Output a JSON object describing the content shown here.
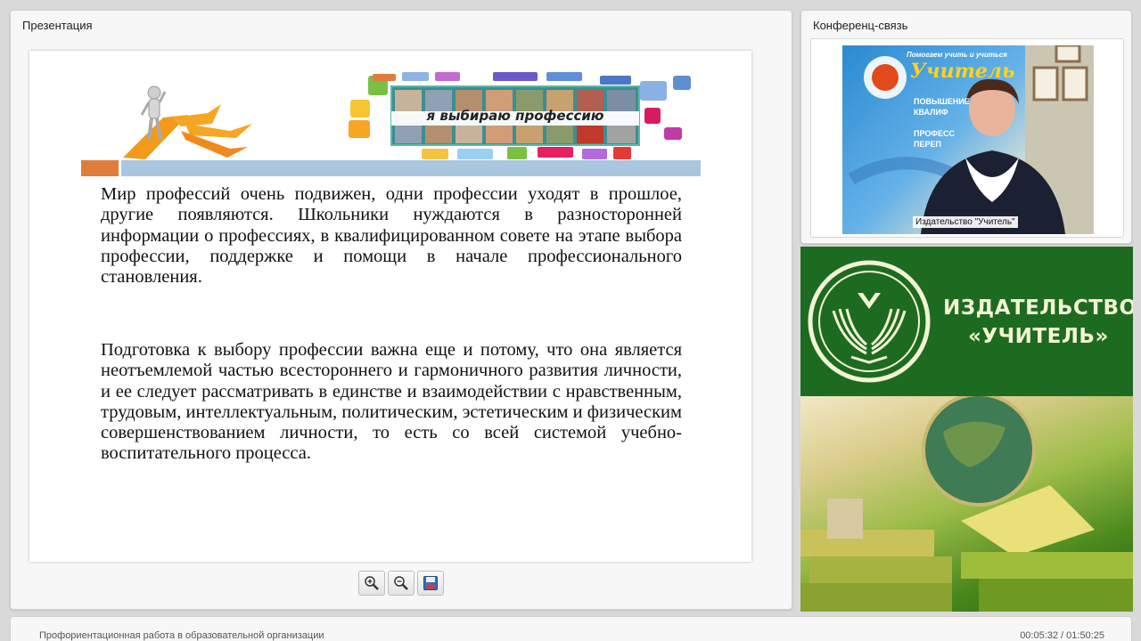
{
  "presentation": {
    "title": "Презентация",
    "slide": {
      "banner_caption": "я выбираю профессию",
      "paragraph1": "Мир профессий очень подвижен, одни профессии уходят в прошлое, другие появляются. Школьники нуждаются в разносторонней информации о профессиях, в квалифицированном совете на этапе выбора профессии, поддержке и помощи в начале профессионального становления.",
      "paragraph2": "Подготовка к выбору профессии важна еще и потому, что она является неотъемлемой частью всестороннего и гармоничного развития личности, и ее следует рассматривать в единстве и взаимодействии с нравственным, трудовым, интеллектуальным, политическим, эстетическим и физическим совершенствованием личности, то есть со всей системой учебно-воспитательного процесса."
    },
    "toolbar": {
      "zoom_in_icon": "zoom-in-icon",
      "zoom_out_icon": "zoom-out-icon",
      "save_icon": "floppy-disk-icon"
    }
  },
  "conference": {
    "title": "Конференц-связь",
    "video_label": "Издательство \"Учитель\"",
    "poster_text": [
      "Помогаем учить и учиться",
      "Учитель",
      "ПОВЫШЕНИЕ",
      "КВАЛИФ",
      "ПРОФЕСС",
      "ПЕРЕП"
    ]
  },
  "brand": {
    "line1": "ИЗДАТЕЛЬСТВО",
    "line2": "«УЧИТЕЛЬ»"
  },
  "footer": {
    "title": "Профориентационная работа в образовательной организации",
    "time": "00:05:32 / 01:50:25"
  },
  "colors": {
    "brand_green": "#1d6b20",
    "brand_text": "#f3f3d5",
    "slide_bar_blue": "#a9c6df",
    "slide_bar_orange": "#e07d3c"
  }
}
